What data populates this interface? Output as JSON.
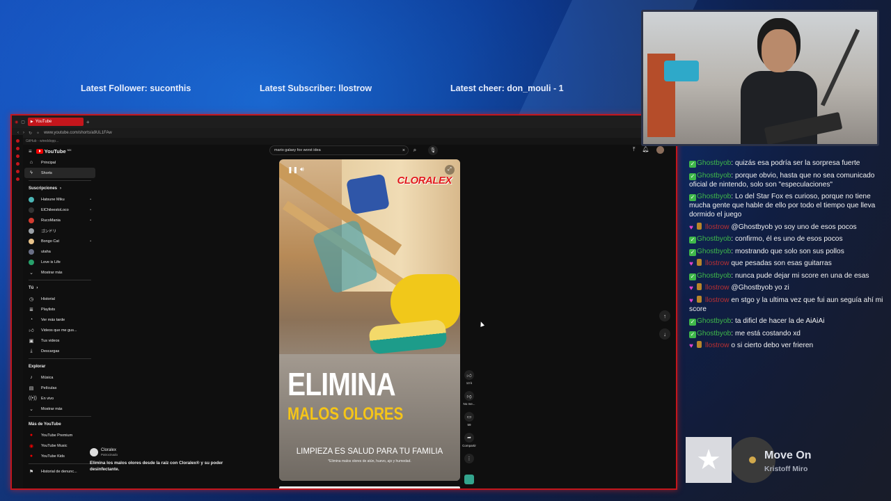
{
  "overlay": {
    "latest_follower": "Latest Follower: suconthis",
    "latest_subscriber": "Latest Subscriber: llostrow",
    "latest_cheer": "Latest cheer: don_mouli - 1"
  },
  "browser": {
    "tab_title": "YouTube",
    "url": "www.youtube.com/shorts/a9UL1FAw",
    "bookmark": "GitHub - wireddopp..."
  },
  "youtube": {
    "logo_text": "YouTube",
    "logo_sup": "MX",
    "search_value": "mario galaxy fox worst idea",
    "sidebar": {
      "main": [
        {
          "label": "Principal",
          "icon": "home-icon"
        },
        {
          "label": "Shorts",
          "icon": "shorts-icon"
        }
      ],
      "subscriptions_title": "Suscripciones",
      "subscriptions": [
        {
          "label": "Hatsune Miku",
          "color": "#4bb5b5"
        },
        {
          "label": "ElChileestoLoco",
          "color": "#222222"
        },
        {
          "label": "RucoMania",
          "color": "#d33b2f"
        },
        {
          "label": "ゴンドリ",
          "color": "#9aa0a6"
        },
        {
          "label": "Bongo Cat",
          "color": "#e8c38b"
        },
        {
          "label": "utaha",
          "color": "#6a6f86"
        },
        {
          "label": "Love is Life",
          "color": "#27a06a"
        }
      ],
      "show_more": "Mostrar más",
      "you_title": "Tú",
      "you_items": [
        {
          "label": "Historial",
          "icon": "history-icon"
        },
        {
          "label": "Playlists",
          "icon": "playlist-icon"
        },
        {
          "label": "Ver más tarde",
          "icon": "clock-icon"
        },
        {
          "label": "Videos que me gus...",
          "icon": "thumb-up-icon"
        },
        {
          "label": "Tus videos",
          "icon": "video-icon"
        },
        {
          "label": "Descargas",
          "icon": "download-icon"
        }
      ],
      "explore_title": "Explorar",
      "explore_items": [
        {
          "label": "Música",
          "icon": "music-icon"
        },
        {
          "label": "Películas",
          "icon": "film-icon"
        },
        {
          "label": "En vivo",
          "icon": "live-icon"
        },
        {
          "label": "Mostrar más",
          "icon": "chevron-down-icon"
        }
      ],
      "more_title": "Más de YouTube",
      "more_items": [
        {
          "label": "YouTube Premium"
        },
        {
          "label": "YouTube Music"
        },
        {
          "label": "YouTube Kids"
        }
      ],
      "report_history": "Historial de denunc..."
    },
    "video": {
      "brand": "CLORALEX",
      "headline": "ELIMINA",
      "subheadline": "MALOS OLORES",
      "tagline": "LIMPIEZA ES SALUD PARA TU FAMILIA",
      "fineprint": "*Elimina malos olores de atún, huevo, ajo y humedad."
    },
    "actions": {
      "likes": "13 k",
      "dislike": "No me...",
      "comments": "59",
      "share": "Compartir"
    },
    "sponsor": {
      "channel": "Cloralex",
      "label": "Patrocinado",
      "description": "Elimina los malos olores desde la raíz con Cloralex® y su poder desinfectante."
    }
  },
  "chat": [
    {
      "user": "Ghostbyob",
      "badge": "check",
      "text": "quizás esa podría ser la sorpresa fuerte"
    },
    {
      "user": "Ghostbyob",
      "badge": "check",
      "text": "porque obvio, hasta que no sea comunicado oficial de nintendo, solo son \"especulaciones\""
    },
    {
      "user": "Ghostbyob",
      "badge": "check",
      "text": "Lo del Star Fox es curioso, porque no tiene mucha gente que hable de ello por todo el tiempo que lleva dormido el juego"
    },
    {
      "user": "llostrow",
      "badge": "heart",
      "text": "@Ghostbyob yo soy uno de esos pocos"
    },
    {
      "user": "Ghostbyob",
      "badge": "check",
      "text": "confirmo, él es uno de esos pocos"
    },
    {
      "user": "Ghostbyob",
      "badge": "check",
      "text": "mostrando que solo son sus pollos"
    },
    {
      "user": "llostrow",
      "badge": "heart",
      "text": "que pesadas son esas guitarras"
    },
    {
      "user": "Ghostbyob",
      "badge": "check",
      "text": "nunca pude dejar mi score en una de esas"
    },
    {
      "user": "llostrow",
      "badge": "heart",
      "text": "@Ghostbyob yo zi"
    },
    {
      "user": "llostrow",
      "badge": "heart",
      "text": "en stgo y la ultima vez que fui aun seguía ahí mi score"
    },
    {
      "user": "Ghostbyob",
      "badge": "check",
      "text": "ta dificl de hacer la de AiAiAi"
    },
    {
      "user": "Ghostbyob",
      "badge": "check",
      "text": "me está costando xd"
    },
    {
      "user": "llostrow",
      "badge": "heart",
      "text": "o si cierto debo ver frieren"
    }
  ],
  "now_playing": {
    "title": "Move On",
    "artist": "Kristoff Miro"
  }
}
